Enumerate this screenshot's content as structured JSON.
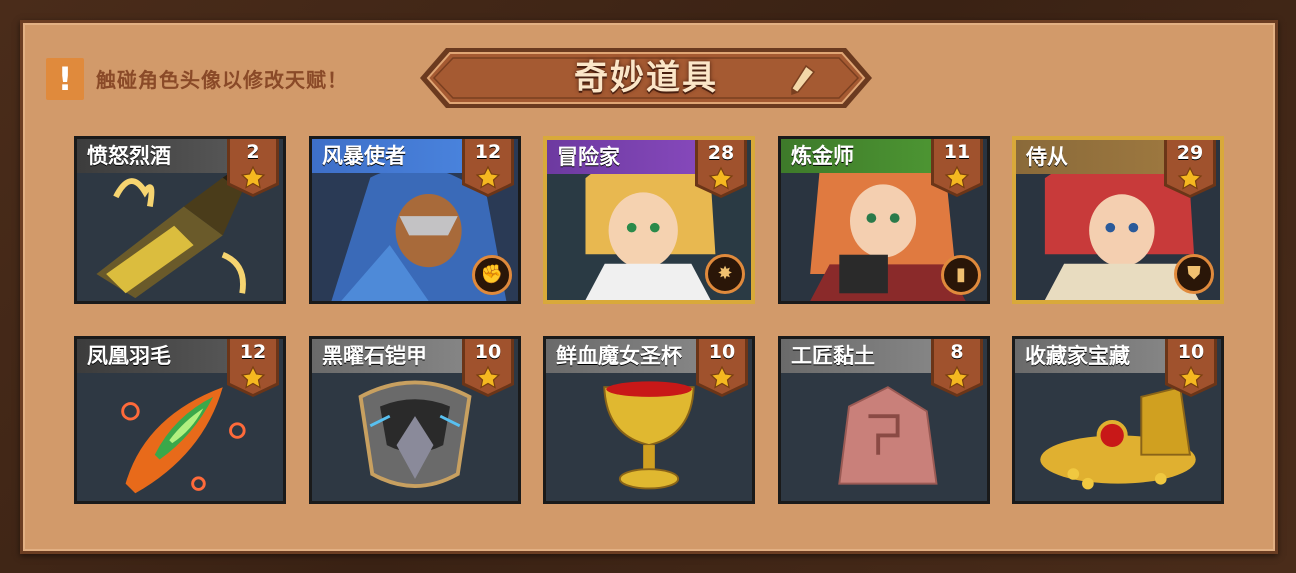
{
  "hint": "触碰角色头像以修改天赋！",
  "title": "奇妙道具",
  "colors": {
    "panel": "#d29a6a",
    "banner": "#a55a32",
    "badge": "#a0522d",
    "star": "#f5b820",
    "accent": "#e08a3c"
  },
  "cards": [
    {
      "name": "愤怒烈酒",
      "level": "2",
      "style": "lbl-dark",
      "gold": false,
      "art": "bottle",
      "class_icon": ""
    },
    {
      "name": "风暴使者",
      "level": "12",
      "style": "lbl-blue",
      "gold": false,
      "art": "hero-blue",
      "class_icon": "fist-icon"
    },
    {
      "name": "冒险家",
      "level": "28",
      "style": "lbl-purple",
      "gold": true,
      "art": "hero-blonde",
      "class_icon": "burst-icon"
    },
    {
      "name": "炼金师",
      "level": "11",
      "style": "lbl-green",
      "gold": false,
      "art": "hero-redhair",
      "class_icon": "book-icon"
    },
    {
      "name": "侍从",
      "level": "29",
      "style": "lbl-brown",
      "gold": true,
      "art": "hero-red",
      "class_icon": "shield-icon"
    },
    {
      "name": "凤凰羽毛",
      "level": "12",
      "style": "lbl-dark",
      "gold": false,
      "art": "feather",
      "class_icon": ""
    },
    {
      "name": "黑曜石铠甲",
      "level": "10",
      "style": "lbl-gray",
      "gold": false,
      "art": "armor",
      "class_icon": ""
    },
    {
      "name": "鲜血魔女圣杯",
      "level": "10",
      "style": "lbl-gray",
      "gold": false,
      "art": "grail",
      "class_icon": ""
    },
    {
      "name": "工匠黏土",
      "level": "8",
      "style": "lbl-gray",
      "gold": false,
      "art": "clay",
      "class_icon": ""
    },
    {
      "name": "收藏家宝藏",
      "level": "10",
      "style": "lbl-gray",
      "gold": false,
      "art": "treasure",
      "class_icon": ""
    }
  ]
}
